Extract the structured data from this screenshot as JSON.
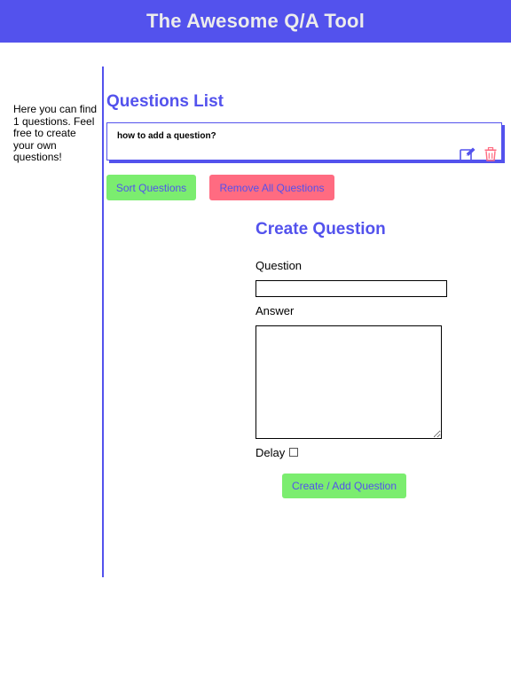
{
  "header": {
    "title": "The Awesome Q/A Tool"
  },
  "sidebar": {
    "text": "Here you can find 1 questions. Feel free to create your own questions!"
  },
  "questions_list": {
    "title": "Questions List",
    "items": [
      {
        "question": "how to add a question?"
      }
    ]
  },
  "actions": {
    "sort_label": "Sort Questions",
    "remove_all_label": "Remove All Questions"
  },
  "create_form": {
    "title": "Create Question",
    "question_label": "Question",
    "question_value": "",
    "answer_label": "Answer",
    "answer_value": "",
    "delay_label": "Delay",
    "delay_checked": false,
    "submit_label": "Create / Add Question"
  },
  "colors": {
    "primary": "#5352ed",
    "success": "#7bed6f",
    "danger": "#ff6b81",
    "header_text": "#ececec"
  },
  "icons": {
    "edit": "edit-icon",
    "delete": "trash-icon"
  }
}
